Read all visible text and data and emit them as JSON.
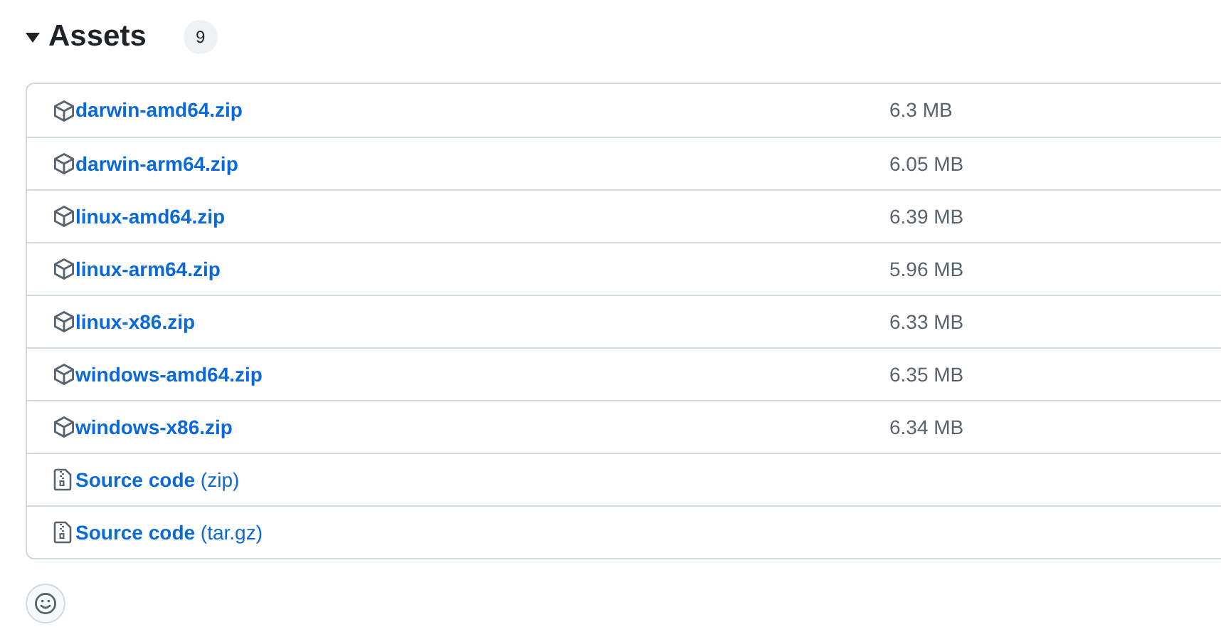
{
  "section": {
    "title": "Assets",
    "expanded": true,
    "count": "9"
  },
  "assets": [
    {
      "kind": "package",
      "name": "darwin-amd64.zip",
      "size": "6.3 MB"
    },
    {
      "kind": "package",
      "name": "darwin-arm64.zip",
      "size": "6.05 MB"
    },
    {
      "kind": "package",
      "name": "linux-amd64.zip",
      "size": "6.39 MB"
    },
    {
      "kind": "package",
      "name": "linux-arm64.zip",
      "size": "5.96 MB"
    },
    {
      "kind": "package",
      "name": "linux-x86.zip",
      "size": "6.33 MB"
    },
    {
      "kind": "package",
      "name": "windows-amd64.zip",
      "size": "6.35 MB"
    },
    {
      "kind": "package",
      "name": "windows-x86.zip",
      "size": "6.34 MB"
    },
    {
      "kind": "source",
      "name": "Source code",
      "format": "(zip)"
    },
    {
      "kind": "source",
      "name": "Source code",
      "format": "(tar.gz)"
    }
  ]
}
